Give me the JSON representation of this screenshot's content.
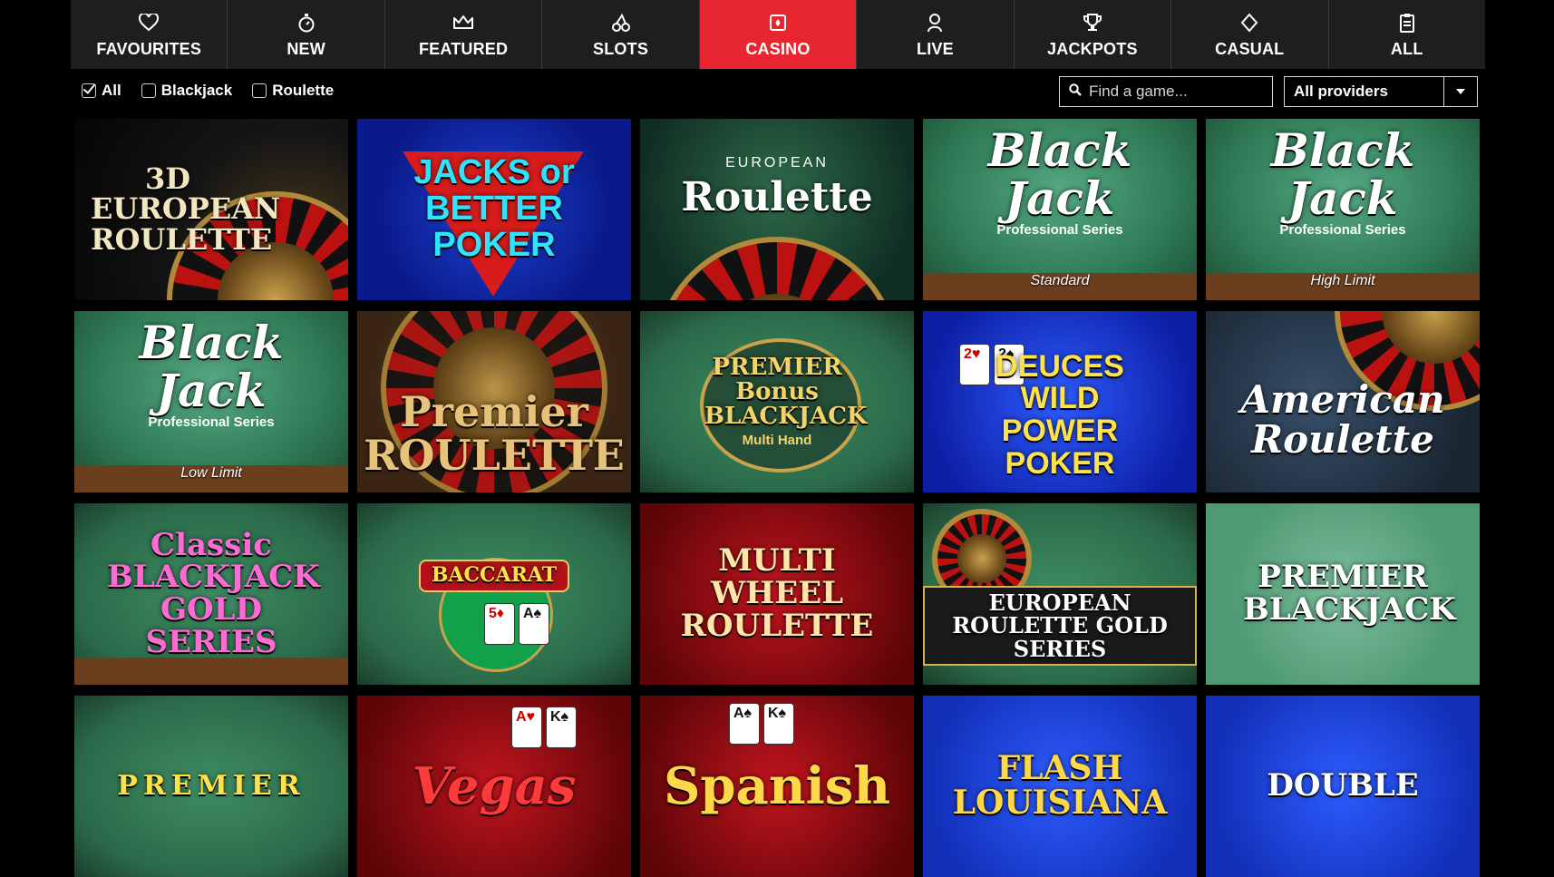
{
  "nav": {
    "items": [
      {
        "label": "FAVOURITES",
        "icon": "heart-icon"
      },
      {
        "label": "NEW",
        "icon": "stopwatch-icon"
      },
      {
        "label": "FEATURED",
        "icon": "crown-icon"
      },
      {
        "label": "SLOTS",
        "icon": "cherries-icon"
      },
      {
        "label": "CASINO",
        "icon": "cards-icon",
        "active": true
      },
      {
        "label": "LIVE",
        "icon": "dealer-icon"
      },
      {
        "label": "JACKPOTS",
        "icon": "trophy-icon"
      },
      {
        "label": "CASUAL",
        "icon": "diamond-icon"
      },
      {
        "label": "ALL",
        "icon": "clipboard-icon"
      }
    ],
    "active_color": "#e8262f"
  },
  "filters": [
    {
      "label": "All",
      "checked": true
    },
    {
      "label": "Blackjack",
      "checked": false
    },
    {
      "label": "Roulette",
      "checked": false
    }
  ],
  "search": {
    "placeholder": "Find a game..."
  },
  "provider": {
    "selected": "All providers"
  },
  "games": [
    {
      "title": "3D EUROPEAN ROULETTE",
      "style": "bg-black",
      "color": "#f3e7c2"
    },
    {
      "title": "JACKS or BETTER POKER",
      "style": "bg-blue",
      "color": "#2fe3ff"
    },
    {
      "title": "Roulette",
      "style": "bg-darkgreen",
      "color": "#ffffff",
      "overline": "EUROPEAN"
    },
    {
      "title": "Black Jack",
      "style": "bg-table",
      "color": "#ffffff",
      "tagline": "Professional Series",
      "subtitle": "Standard"
    },
    {
      "title": "Black Jack",
      "style": "bg-table",
      "color": "#ffffff",
      "tagline": "Professional Series",
      "subtitle": "High Limit"
    },
    {
      "title": "Black Jack",
      "style": "bg-table",
      "color": "#ffffff",
      "tagline": "Professional Series",
      "subtitle": "Low Limit"
    },
    {
      "title": "Premier ROULETTE",
      "style": "bg-wood",
      "color": "#e7c27a"
    },
    {
      "title": "PREMIER Bonus BLACKJACK",
      "style": "bg-felt",
      "color": "#f2d46a",
      "subtitle": "Multi Hand"
    },
    {
      "title": "DEUCES WILD POWER POKER",
      "style": "bg-royal",
      "color": "#ffe14a"
    },
    {
      "title": "American Roulette",
      "style": "bg-navy",
      "color": "#ffffff"
    },
    {
      "title": "Classic BLACKJACK GOLD SERIES",
      "style": "bg-felt",
      "color": "#ff6ad5"
    },
    {
      "title": "BACCARAT",
      "style": "bg-felt",
      "color": "#ffe14a"
    },
    {
      "title": "MULTI WHEEL ROULETTE",
      "style": "bg-red",
      "color": "#ffe6a8"
    },
    {
      "title": "EUROPEAN ROULETTE GOLD SERIES",
      "style": "bg-felt",
      "color": "#ffffff"
    },
    {
      "title": "PREMIER BLACKJACK",
      "style": "bg-pale",
      "color": "#ffffff"
    },
    {
      "title": "PREMIER",
      "style": "bg-felt",
      "color": "#ffe14a"
    },
    {
      "title": "Vegas",
      "style": "bg-red",
      "color": "#ff3a3a"
    },
    {
      "title": "Spanish",
      "style": "bg-red",
      "color": "#ffd84a"
    },
    {
      "title": "FLASH LOUISIANA",
      "style": "bg-sky",
      "color": "#ffd84a"
    },
    {
      "title": "DOUBLE",
      "style": "bg-sky",
      "color": "#ffffff"
    }
  ]
}
